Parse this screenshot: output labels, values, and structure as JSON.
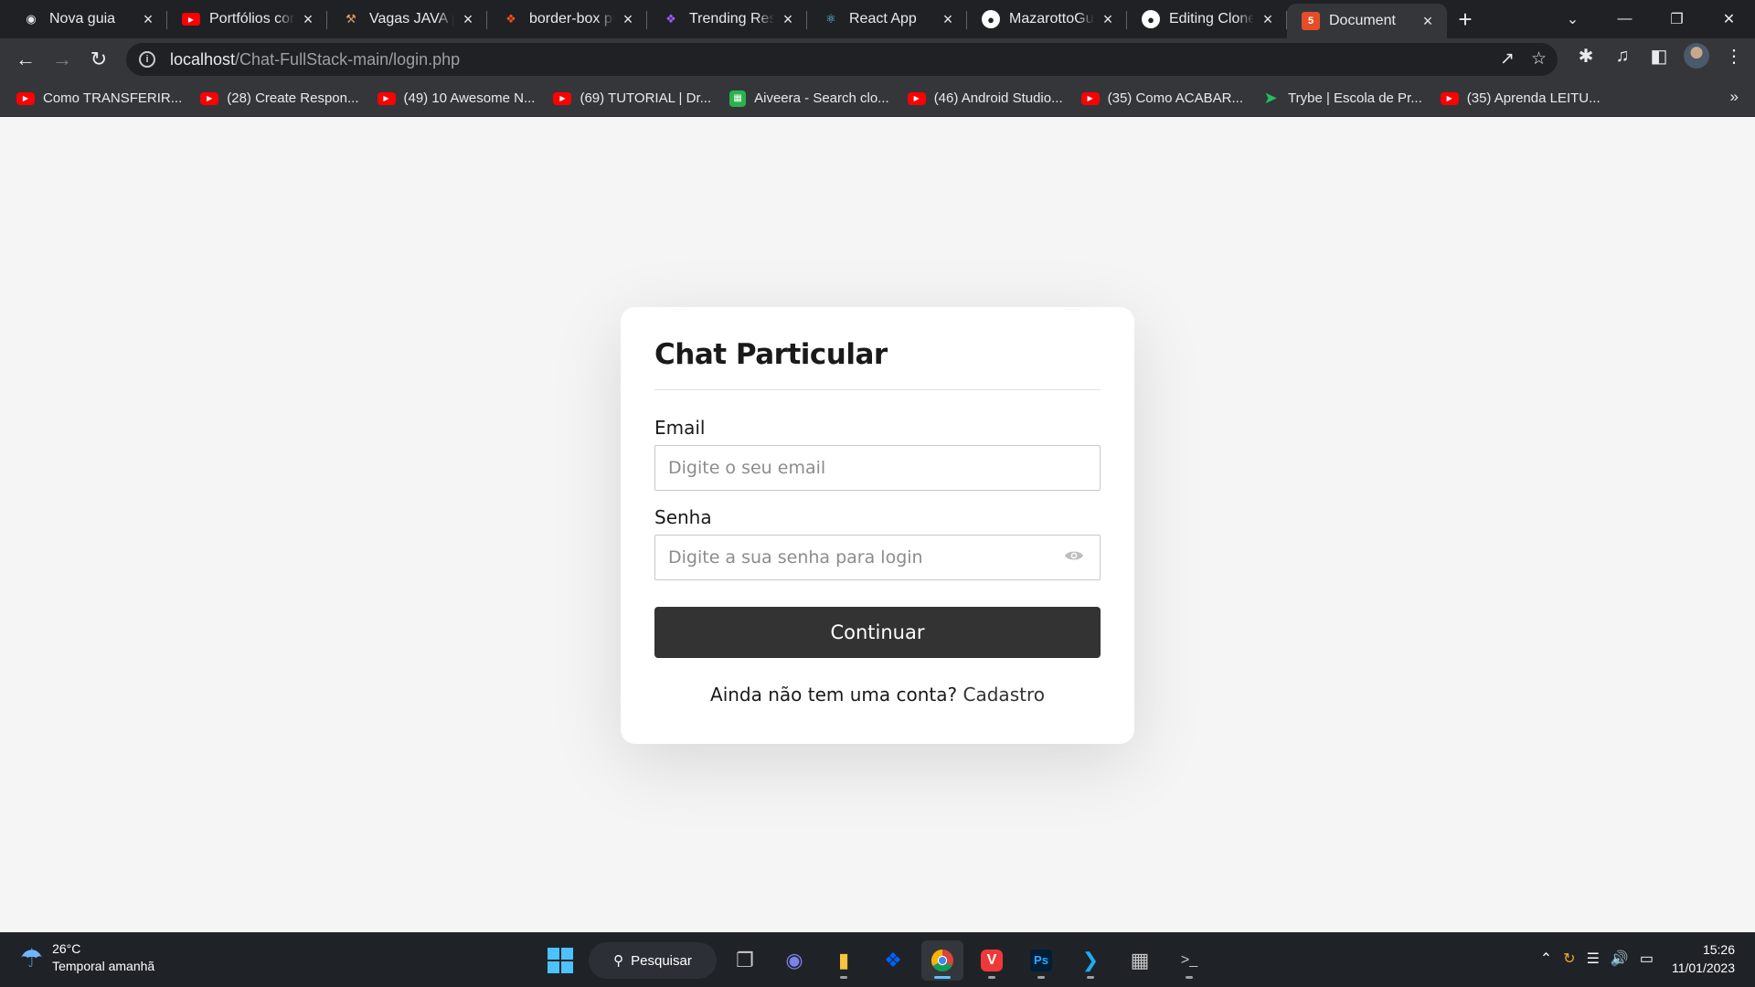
{
  "browser": {
    "tabs": [
      {
        "title": "Nova guia",
        "icon": "chrome-icon"
      },
      {
        "title": "Portfólios com",
        "icon": "youtube-icon"
      },
      {
        "title": "Vagas JAVA pa",
        "icon": "hammer-icon"
      },
      {
        "title": "border-box pr",
        "icon": "figma-icon"
      },
      {
        "title": "Trending Reso",
        "icon": "figma-icon"
      },
      {
        "title": "React App",
        "icon": "react-icon"
      },
      {
        "title": "MazarottoGui",
        "icon": "github-icon"
      },
      {
        "title": "Editing Clone",
        "icon": "github-icon"
      },
      {
        "title": "Document",
        "icon": "html5-icon"
      }
    ],
    "url_host": "localhost",
    "url_path": "/Chat-FullStack-main/login.php",
    "bookmarks": [
      {
        "label": "Como TRANSFERIR...",
        "icon": "youtube-icon"
      },
      {
        "label": "(28) Create Respon...",
        "icon": "youtube-icon"
      },
      {
        "label": "(49) 10 Awesome N...",
        "icon": "youtube-icon"
      },
      {
        "label": "(69) TUTORIAL | Dr...",
        "icon": "youtube-icon"
      },
      {
        "label": "Aiveera - Search clo...",
        "icon": "aiveera-icon"
      },
      {
        "label": "(46) Android Studio...",
        "icon": "youtube-icon"
      },
      {
        "label": "(35) Como ACABAR...",
        "icon": "youtube-icon"
      },
      {
        "label": "Trybe | Escola de Pr...",
        "icon": "trybe-icon"
      },
      {
        "label": "(35) Aprenda LEITU...",
        "icon": "youtube-icon"
      }
    ]
  },
  "login": {
    "title": "Chat Particular",
    "email_label": "Email",
    "email_placeholder": "Digite o seu email",
    "password_label": "Senha",
    "password_placeholder": "Digite a sua senha para login",
    "submit_label": "Continuar",
    "signup_text": "Ainda não tem uma conta?",
    "signup_link": "Cadastro"
  },
  "taskbar": {
    "temperature": "26°C",
    "forecast": "Temporal amanhã",
    "search_label": "Pesquisar",
    "time": "15:26",
    "date": "11/01/2023"
  },
  "colors": {
    "page_bg": "#f5f5f5",
    "card_bg": "#ffffff",
    "button_bg": "#333333",
    "chrome_dark": "#202124",
    "chrome_toolbar": "#35363a"
  }
}
